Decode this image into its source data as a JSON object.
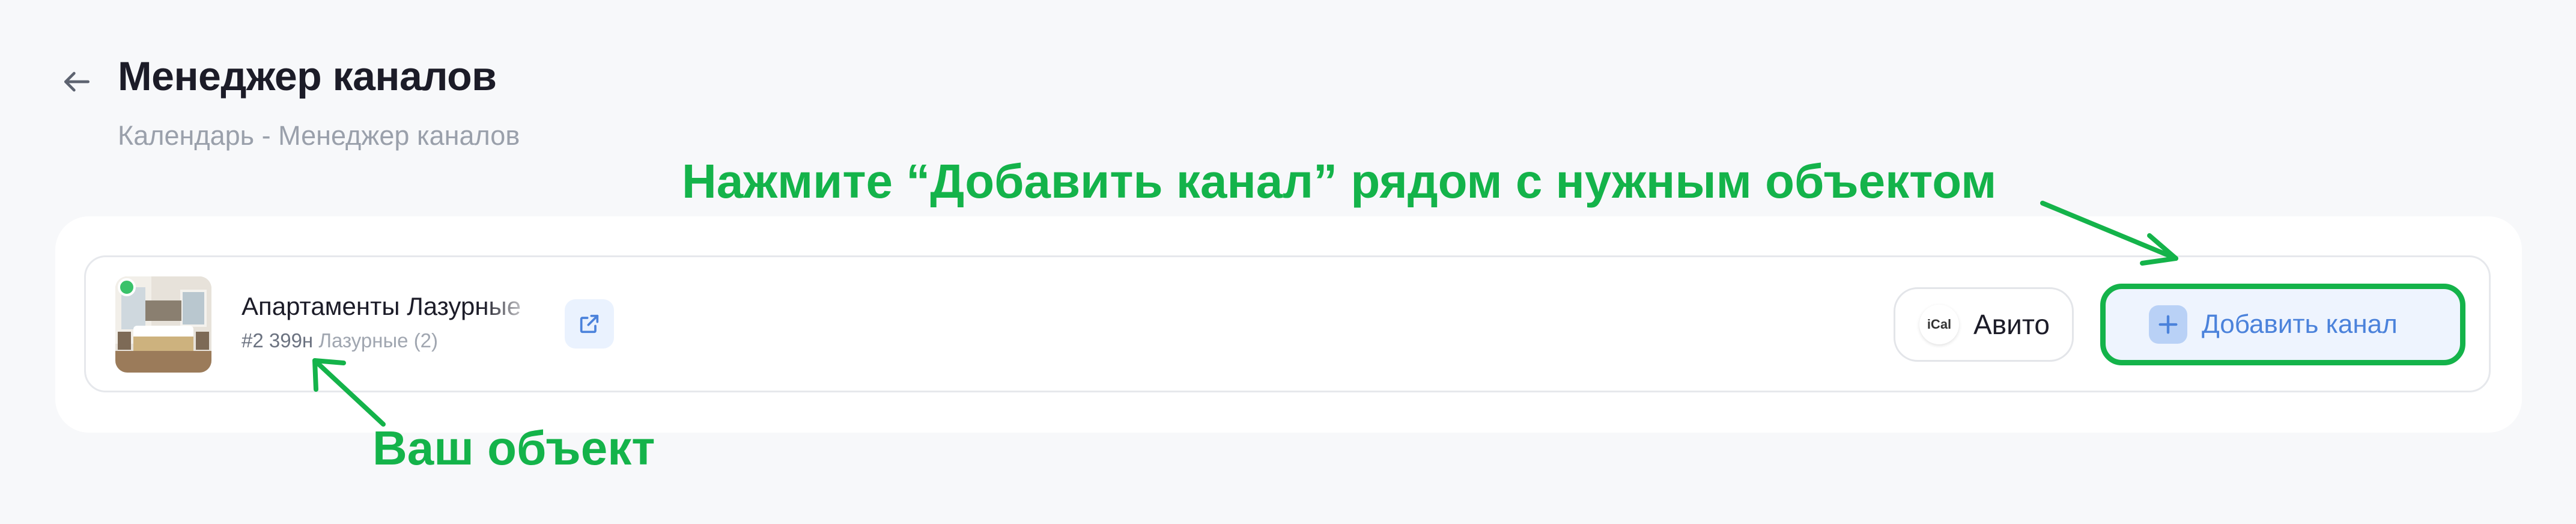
{
  "header": {
    "title": "Менеджер каналов",
    "breadcrumb": "Календарь - Менеджер каналов"
  },
  "hints": {
    "add_channel": "Нажмите “Добавить канал” рядом с нужным объектом",
    "your_object": "Ваш объект"
  },
  "property": {
    "name": "Апартаменты Лазурные",
    "id": "#2 399н",
    "group": "Лазурные (2)",
    "status": "active"
  },
  "channels": [
    {
      "badge": "iCal",
      "label": "Авито"
    }
  ],
  "actions": {
    "add_channel_label": "Добавить канал"
  },
  "colors": {
    "accent_green": "#14b34a",
    "accent_blue": "#4b82db",
    "status_dot": "#3ac26a"
  }
}
